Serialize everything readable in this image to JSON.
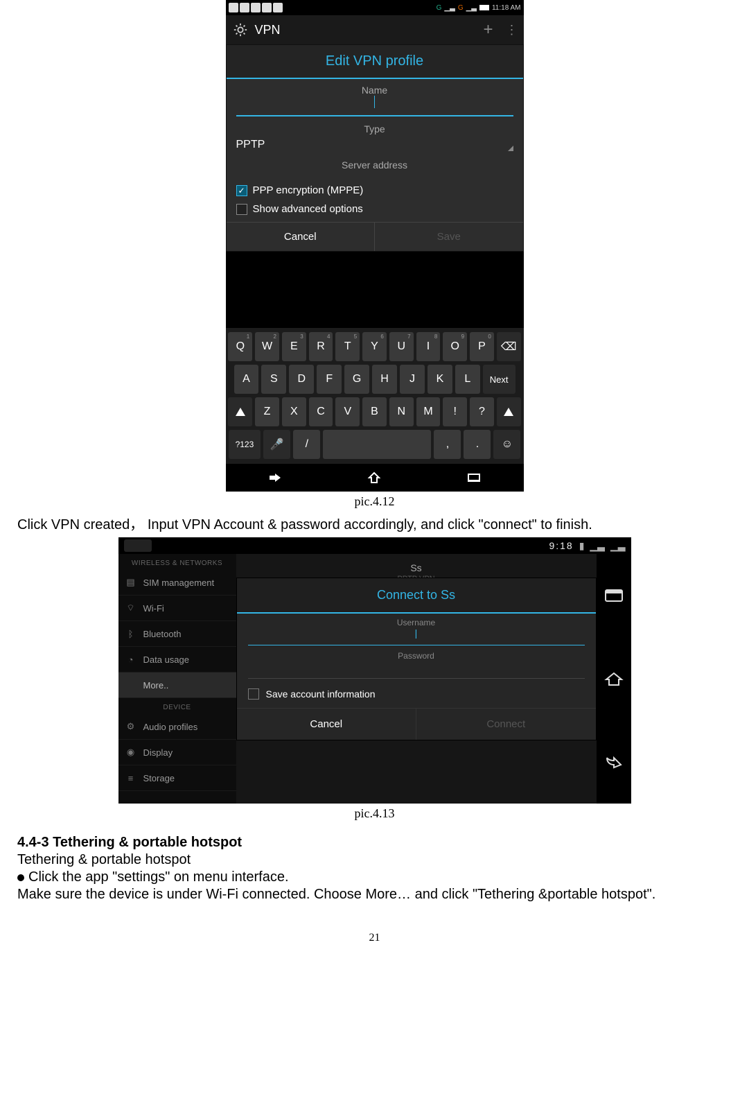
{
  "screenshot1": {
    "statusbar": {
      "signal1": "G",
      "signal2": "G",
      "time": "11:18 AM"
    },
    "appbar": {
      "title": "VPN"
    },
    "dialog": {
      "title": "Edit VPN profile",
      "name_label": "Name",
      "name_value": "",
      "type_label": "Type",
      "type_value": "PPTP",
      "server_label": "Server address",
      "check_ppp": "PPP encryption (MPPE)",
      "check_adv": "Show advanced options",
      "cancel": "Cancel",
      "save": "Save"
    },
    "keyboard": {
      "row1": [
        "Q",
        "W",
        "E",
        "R",
        "T",
        "Y",
        "U",
        "I",
        "O",
        "P"
      ],
      "row1_sup": [
        "1",
        "2",
        "3",
        "4",
        "5",
        "6",
        "7",
        "8",
        "9",
        "0"
      ],
      "row2": [
        "A",
        "S",
        "D",
        "F",
        "G",
        "H",
        "J",
        "K",
        "L"
      ],
      "next": "Next",
      "row3": [
        "Z",
        "X",
        "C",
        "V",
        "B",
        "N",
        "M",
        "!",
        "?"
      ],
      "row4": {
        "sym": "?123"
      }
    }
  },
  "caption1": "pic.4.12",
  "para1": "Click VPN created，   Input VPN Account & password accordingly, and click \"connect\" to finish.",
  "screenshot2": {
    "statusbar": {
      "time": "9:18"
    },
    "sidebar": {
      "head1": "WIRELESS & NETWORKS",
      "items1": [
        "SIM management",
        "Wi-Fi",
        "Bluetooth",
        "Data usage",
        "More.."
      ],
      "head2": "DEVICE",
      "items2": [
        "Audio profiles",
        "Display",
        "Storage"
      ]
    },
    "vpn_row": {
      "name": "Ss",
      "sub": "PPTP VPN"
    },
    "dialog": {
      "title": "Connect to Ss",
      "username_label": "Username",
      "username_value": "",
      "password_label": "Password",
      "password_value": "",
      "save_info": "Save account information",
      "cancel": "Cancel",
      "connect": "Connect"
    }
  },
  "caption2": "pic.4.13",
  "section_head": "4.4-3 Tethering & portable hotspot",
  "para2": "Tethering & portable hotspot",
  "bullet1": "Click the app \"settings\" on menu interface.",
  "para3": " Make sure the device is under Wi-Fi connected. Choose More… and click \"Tethering &portable hotspot\".",
  "page_number": "21"
}
